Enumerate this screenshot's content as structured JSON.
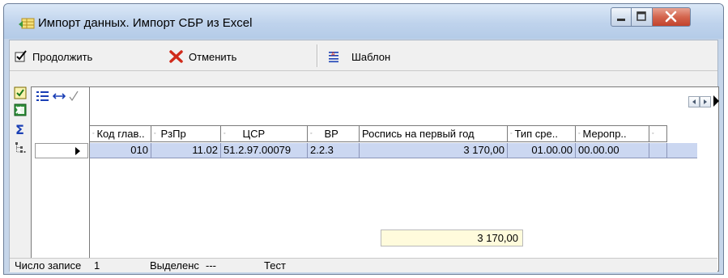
{
  "window": {
    "title": "Импорт данных. Импорт СБР из Excel"
  },
  "toolbar": {
    "continue_label": "Продолжить",
    "cancel_label": "Отменить",
    "template_label": "Шаблон"
  },
  "grid": {
    "columns": [
      "Код глав..",
      "РзПр",
      "ЦСР",
      "ВР",
      "Роспись на первый год",
      "Тип сре..",
      "Меропр.."
    ],
    "rows": [
      [
        "010",
        "11.02",
        "51.2.97.00079",
        "2.2.3",
        "3 170,00",
        "01.00.00",
        "00.00.00"
      ]
    ],
    "total": "3 170,00"
  },
  "statusbar": {
    "records_label": "Число записе",
    "records_value": "1",
    "selected_label": "Выделенс",
    "selected_value": "---",
    "test_label": "Тест"
  },
  "colors": {
    "selected_row": "#cbd7f1",
    "total_bg": "#fffbdc",
    "close_button": "#c94a33"
  }
}
